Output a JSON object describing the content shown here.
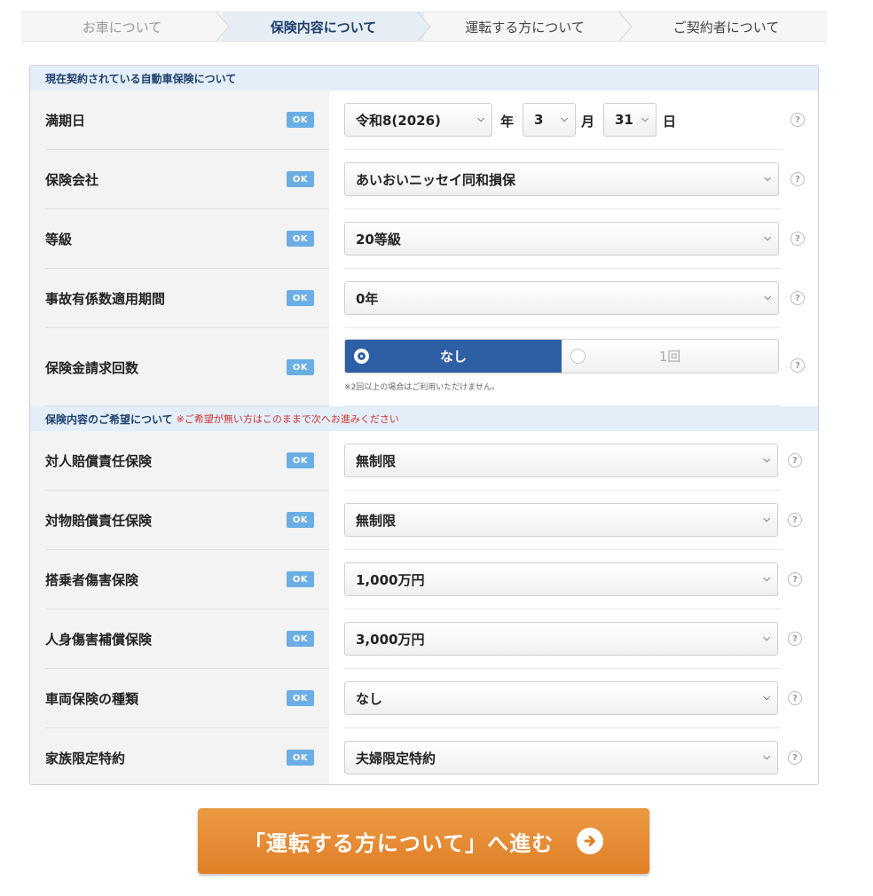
{
  "steps": [
    "お車について",
    "保険内容について",
    "運転する方について",
    "ご契約者について"
  ],
  "ok_label": "OK",
  "help_label": "?",
  "section1": {
    "title": "現在契約されている自動車保険について",
    "expiry": {
      "label": "満期日",
      "era": "令和8(2026)",
      "year_unit": "年",
      "month": "3",
      "month_unit": "月",
      "day": "31",
      "day_unit": "日"
    },
    "company": {
      "label": "保険会社",
      "value": "あいおいニッセイ同和損保"
    },
    "grade": {
      "label": "等級",
      "value": "20等級"
    },
    "accident": {
      "label": "事故有係数適用期間",
      "value": "0年"
    },
    "claims": {
      "label": "保険金請求回数",
      "option_none": "なし",
      "option_one": "1回",
      "note": "※2回以上の場合はご利用いただけません。"
    }
  },
  "section2": {
    "title": "保険内容のご希望について",
    "note": "※ご希望が無い方はこのままで次へお進みください",
    "rows": [
      {
        "label": "対人賠償責任保険",
        "value": "無制限"
      },
      {
        "label": "対物賠償責任保険",
        "value": "無制限"
      },
      {
        "label": "搭乗者傷害保険",
        "value": "1,000万円"
      },
      {
        "label": "人身傷害補償保険",
        "value": "3,000万円"
      },
      {
        "label": "車両保険の種類",
        "value": "なし"
      },
      {
        "label": "家族限定特約",
        "value": "夫婦限定特約"
      }
    ]
  },
  "cta": {
    "label": "「運転する方について」へ進む"
  },
  "colors": {
    "accent": "#2e5fa5",
    "ok_badge": "#6aaee5",
    "cta": "#e8892f",
    "section_head": "#e3eef8",
    "note_red": "#d23232"
  }
}
